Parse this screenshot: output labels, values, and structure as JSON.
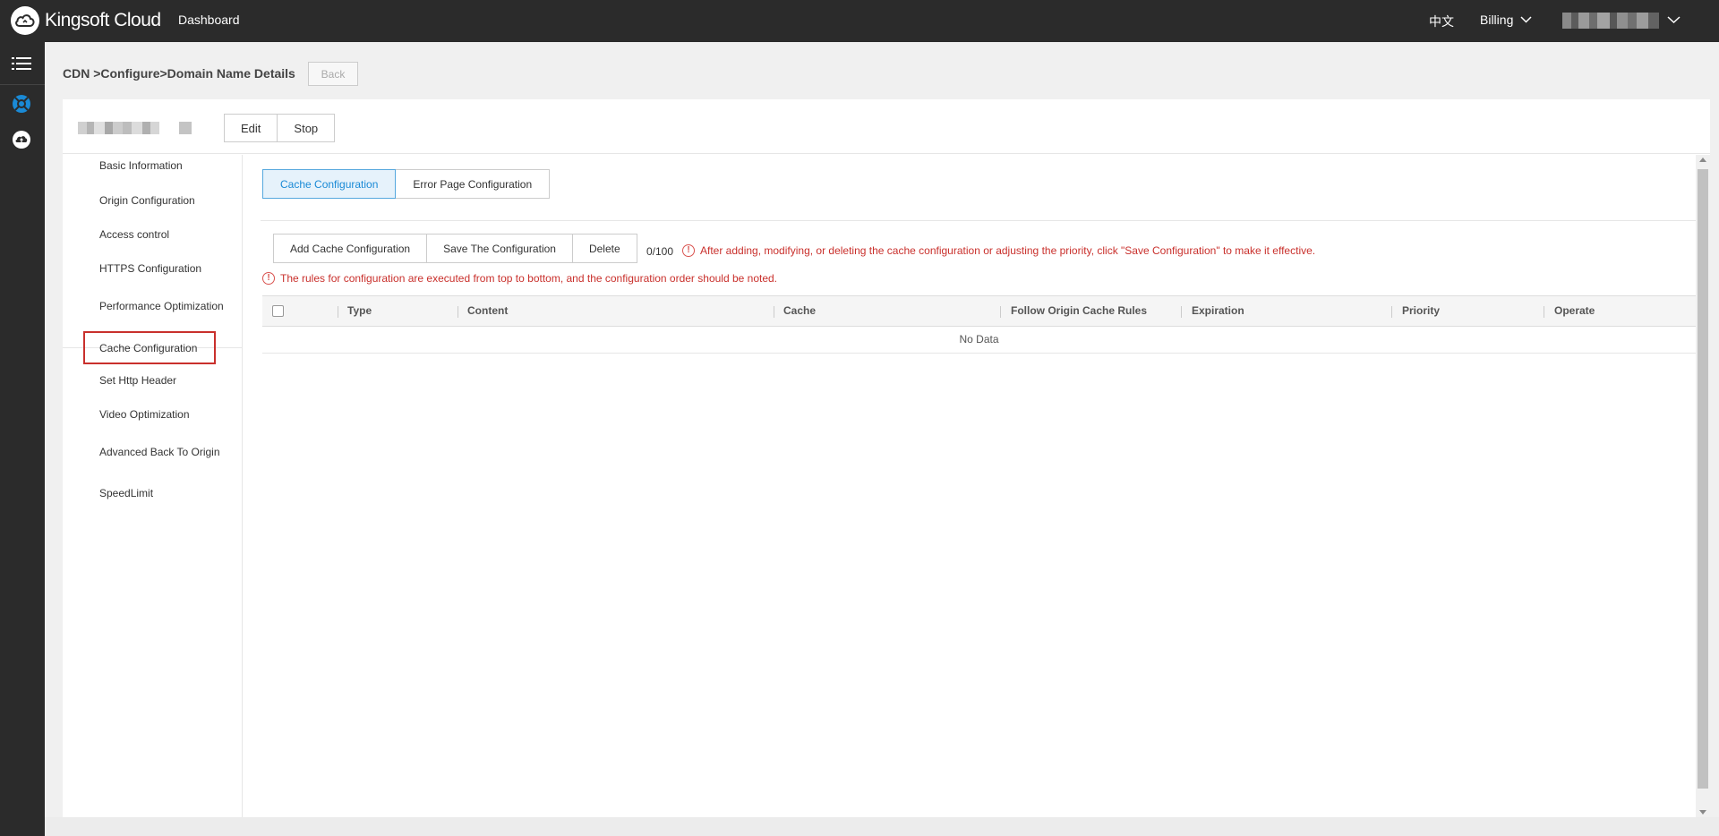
{
  "topbar": {
    "brand": "Kingsoft Cloud",
    "dashboard": "Dashboard",
    "language": "中文",
    "billing": "Billing"
  },
  "breadcrumb": {
    "text": "CDN >Configure>Domain Name Details",
    "back": "Back"
  },
  "domain_actions": {
    "edit": "Edit",
    "stop": "Stop"
  },
  "sidenav": {
    "items": [
      {
        "label": "Basic Information"
      },
      {
        "label": "Origin Configuration"
      },
      {
        "label": "Access control"
      },
      {
        "label": "HTTPS Configuration"
      },
      {
        "label": "Performance Optimization"
      },
      {
        "label": "Cache Configuration",
        "active": true
      },
      {
        "label": "Set Http Header"
      },
      {
        "label": "Video Optimization"
      },
      {
        "label": "Advanced Back To Origin"
      },
      {
        "label": "SpeedLimit"
      }
    ]
  },
  "tabs": [
    {
      "label": "Cache Configuration",
      "active": true
    },
    {
      "label": "Error Page Configuration",
      "active": false
    }
  ],
  "actions": {
    "add": "Add Cache Configuration",
    "save": "Save The Configuration",
    "delete": "Delete",
    "count": "0/100"
  },
  "warnings": {
    "save_notice": "After adding, modifying, or deleting the cache configuration or adjusting the priority, click \"Save Configuration\" to make it effective.",
    "order_notice": "The rules for configuration are executed from top to bottom, and the configuration order should be noted."
  },
  "table": {
    "columns": [
      "Type",
      "Content",
      "Cache",
      "Follow Origin Cache Rules",
      "Expiration",
      "Priority",
      "Operate"
    ],
    "empty_text": "No Data"
  },
  "colors": {
    "topbar_bg": "#2b2b2b",
    "accent": "#1a8ad6",
    "warning": "#c9302c"
  },
  "icons": {
    "menu": "list-icon",
    "rail_primary": "cdn-icon",
    "rail_secondary": "cloud-upload-icon",
    "warning": "exclamation-circle-icon"
  }
}
